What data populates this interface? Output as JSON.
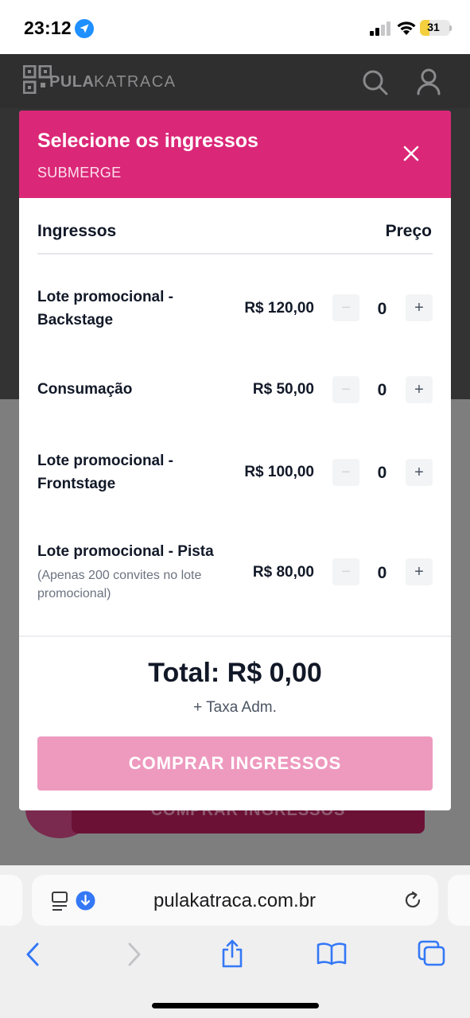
{
  "status_bar": {
    "time": "23:12",
    "battery": "31",
    "battery_level": 0.31
  },
  "site": {
    "logo_bold": "PULA",
    "logo_light": "KATRACA",
    "background_button": "COMPRAR INGRESSOS"
  },
  "modal": {
    "title": "Selecione os ingressos",
    "subtitle": "SUBMERGE",
    "column_tickets": "Ingressos",
    "column_price": "Preço",
    "tickets": [
      {
        "name": "Lote promocional - Backstage",
        "note": "",
        "price": "R$ 120,00",
        "quantity": "0",
        "minus": "−",
        "plus": "+"
      },
      {
        "name": "Consumação",
        "note": "",
        "price": "R$ 50,00",
        "quantity": "0",
        "minus": "−",
        "plus": "+"
      },
      {
        "name": "Lote promocional - Frontstage",
        "note": "",
        "price": "R$ 100,00",
        "quantity": "0",
        "minus": "−",
        "plus": "+"
      },
      {
        "name": "Lote promocional - Pista",
        "note": "(Apenas 200 convites no lote promocional)",
        "price": "R$ 80,00",
        "quantity": "0",
        "minus": "−",
        "plus": "+"
      }
    ],
    "total": "Total: R$ 0,00",
    "fee": "+ Taxa Adm.",
    "buy_button": "COMPRAR INGRESSOS"
  },
  "browser": {
    "url": "pulakatraca.com.br"
  },
  "colors": {
    "brand_pink": "#db2777",
    "button_disabled": "#ee9abf",
    "ios_blue": "#3478f6"
  }
}
